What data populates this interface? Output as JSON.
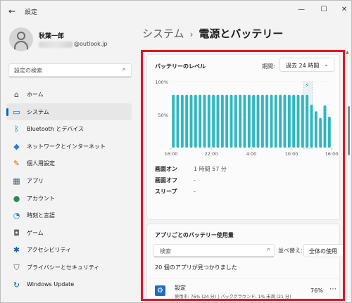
{
  "window": {
    "title": "設定"
  },
  "profile": {
    "name": "秋葉一郎",
    "email_suffix": "@outlook.jp"
  },
  "sidebar": {
    "search_placeholder": "設定の検索",
    "items": [
      {
        "label": "ホーム",
        "icon": "home-icon",
        "glyph": "⌂",
        "color": "#444"
      },
      {
        "label": "システム",
        "icon": "system-monitor-icon",
        "glyph": "▭",
        "color": "#0067c0",
        "active": true
      },
      {
        "label": "Bluetooth とデバイス",
        "icon": "bluetooth-icon",
        "glyph": "ᛒ",
        "color": "#0067c0"
      },
      {
        "label": "ネットワークとインターネット",
        "icon": "wifi-icon",
        "glyph": "◆",
        "color": "#2b7cd3"
      },
      {
        "label": "個人用設定",
        "icon": "brush-icon",
        "glyph": "✎",
        "color": "#c86b1a"
      },
      {
        "label": "アプリ",
        "icon": "apps-icon",
        "glyph": "▦",
        "color": "#4b5b6b"
      },
      {
        "label": "アカウント",
        "icon": "account-icon",
        "glyph": "●",
        "color": "#2e8b57"
      },
      {
        "label": "時刻と言語",
        "icon": "time-language-icon",
        "glyph": "◔",
        "color": "#2b7cd3"
      },
      {
        "label": "ゲーム",
        "icon": "gamepad-icon",
        "glyph": "◘",
        "color": "#666"
      },
      {
        "label": "アクセシビリティ",
        "icon": "accessibility-icon",
        "glyph": "✱",
        "color": "#1b5fa6"
      },
      {
        "label": "プライバシーとセキュリティ",
        "icon": "shield-icon",
        "glyph": "⛉",
        "color": "#666"
      },
      {
        "label": "Windows Update",
        "icon": "update-icon",
        "glyph": "↻",
        "color": "#0067c0"
      }
    ]
  },
  "breadcrumb": {
    "parent": "システム",
    "separator": "›",
    "current": "電源とバッテリー"
  },
  "battery": {
    "title": "バッテリーのレベル",
    "period_label": "期間:",
    "period_value": "過去 24 時間",
    "stats": [
      {
        "key": "画面オン",
        "value": "1 時間 57 分"
      },
      {
        "key": "画面オフ",
        "value": "-"
      },
      {
        "key": "スリープ",
        "value": "-"
      }
    ]
  },
  "chart_data": {
    "type": "bar",
    "title": "",
    "y_tick_labels": [
      "100%",
      "50%",
      "0%"
    ],
    "x_tick_labels": [
      "16:00",
      "22:00",
      "4:00",
      "10:00",
      "16:00"
    ],
    "ylim": [
      0,
      100
    ],
    "values": [
      80,
      80,
      80,
      80,
      80,
      80,
      80,
      80,
      80,
      80,
      80,
      80,
      80,
      80,
      80,
      80,
      80,
      80,
      80,
      80,
      80,
      80,
      80,
      80,
      80,
      80,
      80,
      80,
      80,
      80,
      80,
      65,
      55,
      45,
      64,
      47
    ],
    "charging_marker": "⚡",
    "bar_color": "#2fb7bf"
  },
  "usage": {
    "title": "アプリごとのバッテリー使用量",
    "search_placeholder": "検索",
    "sort_label": "並べ替え:",
    "sort_value": "全体の使用",
    "found_text": "20 個のアプリが見つかりました",
    "apps": [
      {
        "name": "設定",
        "detail": "使用中: 76% (24 分) | バックグラウンド: 1% 未満 (21 分)",
        "percent": "76%",
        "icon": "settings-gear-icon"
      }
    ]
  }
}
